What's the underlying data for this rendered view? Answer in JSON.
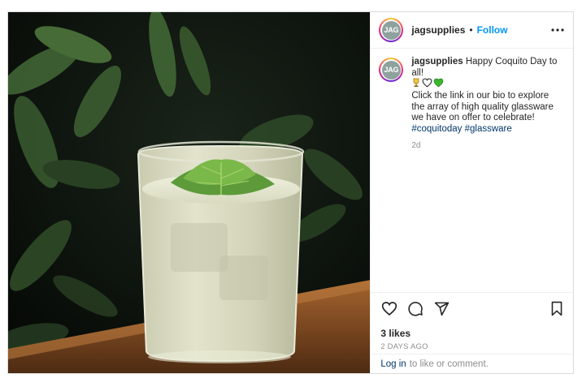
{
  "post": {
    "username": "jagsupplies",
    "avatar_text": "JAG",
    "separator": "•",
    "follow_label": "Follow",
    "more_icon": "more-dots-icon",
    "image": {
      "subject": "iced drink with shiso leaf",
      "colors": {
        "background": "#0b120c",
        "leaves": "#2f4a2a",
        "wood": "#8a5428",
        "drink": "#d6d7bf"
      }
    },
    "caption": {
      "username": "jagsupplies",
      "text_line1": "Happy Coquito Day to all!",
      "emojis": [
        "trophy-emoji",
        "white-heart-emoji",
        "green-heart-emoji"
      ],
      "text_body": "Click the link in our bio to explore the array of high quality glassware we have on offer to celebrate!",
      "hashtag1": "#coquitoday",
      "hashtag2": "#glassware",
      "age": "2d"
    },
    "actions": {
      "like_icon": "heart-icon",
      "comment_icon": "comment-icon",
      "share_icon": "send-icon",
      "save_icon": "bookmark-icon"
    },
    "likes": "3 likes",
    "timestamp": "2 DAYS AGO",
    "login": {
      "link": "Log in",
      "text": "to like or comment."
    },
    "colors": {
      "accent": "#0095f6",
      "link": "#00376b",
      "muted": "#8e8e8e",
      "border": "#dbdbdb"
    }
  }
}
